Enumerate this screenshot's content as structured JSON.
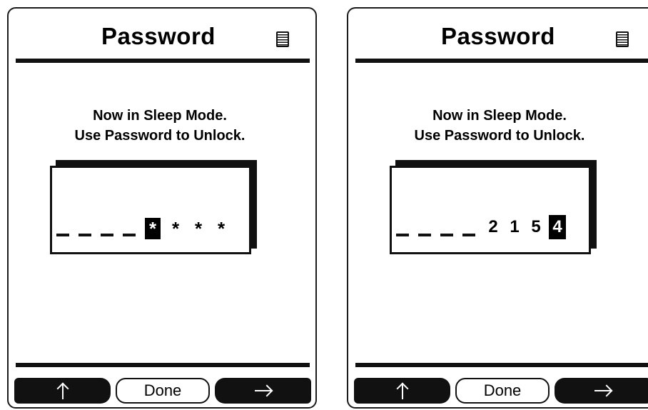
{
  "screens": [
    {
      "title": "Password",
      "message_line1": "Now in Sleep Mode.",
      "message_line2": "Use Password to Unlock.",
      "password": {
        "placeholders": [
          "_",
          "_",
          "_",
          "_"
        ],
        "digits": [
          "*",
          "*",
          "*",
          "*"
        ],
        "active_index": 0
      },
      "softkeys": {
        "left_icon": "up-arrow-icon",
        "middle_label": "Done",
        "right_icon": "right-arrow-icon"
      }
    },
    {
      "title": "Password",
      "message_line1": "Now in Sleep Mode.",
      "message_line2": "Use Password to Unlock.",
      "password": {
        "placeholders": [
          "_",
          "_",
          "_",
          "_"
        ],
        "digits": [
          "2",
          "1",
          "5",
          "4"
        ],
        "active_index": 3
      },
      "softkeys": {
        "left_icon": "up-arrow-icon",
        "middle_label": "Done",
        "right_icon": "right-arrow-icon"
      }
    }
  ],
  "colors": {
    "foreground": "#111111",
    "background": "#ffffff",
    "highlight_bg": "#000000",
    "highlight_fg": "#ffffff"
  },
  "icons": {
    "menu": "menu-list-icon"
  }
}
